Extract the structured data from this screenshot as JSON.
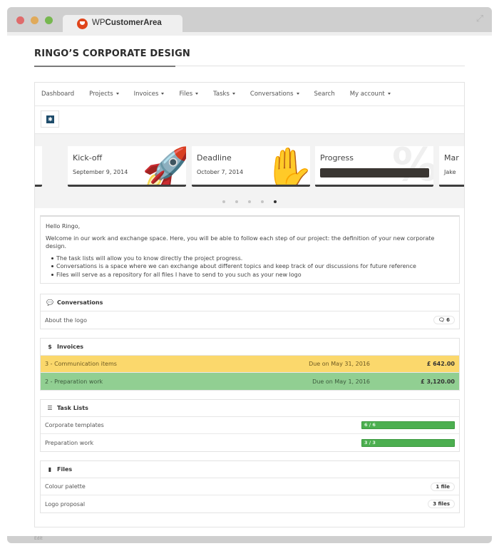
{
  "browser": {
    "tab_title_light": "WP",
    "tab_title_bold": "CustomerArea",
    "brand_color": "#e0451b"
  },
  "page": {
    "title": "RINGO’S CORPORATE DESIGN"
  },
  "nav": {
    "items": [
      {
        "label": "Dashboard",
        "dropdown": false
      },
      {
        "label": "Projects",
        "dropdown": true
      },
      {
        "label": "Invoices",
        "dropdown": true
      },
      {
        "label": "Files",
        "dropdown": true
      },
      {
        "label": "Tasks",
        "dropdown": true
      },
      {
        "label": "Conversations",
        "dropdown": true
      },
      {
        "label": "Search",
        "dropdown": false
      },
      {
        "label": "My account",
        "dropdown": true
      }
    ]
  },
  "toolbar": {
    "icon": "project-icon"
  },
  "carousel": {
    "cards": [
      {
        "title": "Kick-off",
        "subtitle": "September 9, 2014",
        "icon": "rocket-icon"
      },
      {
        "title": "Deadline",
        "subtitle": "October 7, 2014",
        "icon": "hand-stop-icon"
      },
      {
        "title": "Progress",
        "progress": 1.0,
        "icon": "percent-icon"
      },
      {
        "title": "Mar",
        "subtitle": "Jake"
      }
    ],
    "dots": 5,
    "active_dot": 4
  },
  "welcome": {
    "greeting": "Hello Ringo,",
    "intro": "Welcome in our work and exchange space. Here, you will be able to follow each step of our project: the definition of your new corporate design.",
    "bullets": [
      "The task lists will allow you to know directly the project progress.",
      "Conversations is a space where we can exchange about different topics and keep track of our discussions for future reference",
      "Files will serve as a repository for all files I have to send to you such as your new logo"
    ]
  },
  "conversations": {
    "title": "Conversations",
    "items": [
      {
        "label": "About the logo",
        "count": "6"
      }
    ]
  },
  "invoices": {
    "title": "Invoices",
    "items": [
      {
        "label": "3 - Communication items",
        "due": "Due on May 31, 2016",
        "amount": "£ 642.00",
        "status_color": "#fbd86c"
      },
      {
        "label": "2 - Preparation work",
        "due": "Due on May 1, 2016",
        "amount": "£ 3,120.00",
        "status_color": "#91cf92"
      }
    ]
  },
  "tasks": {
    "title": "Task Lists",
    "items": [
      {
        "label": "Corporate templates",
        "progress_text": "6 / 6",
        "progress": 1.0
      },
      {
        "label": "Preparation work",
        "progress_text": "3 / 3",
        "progress": 1.0
      }
    ]
  },
  "files": {
    "title": "Files",
    "items": [
      {
        "label": "Colour palette",
        "count": "1 file"
      },
      {
        "label": "Logo proposal",
        "count": "3 files"
      }
    ]
  },
  "footer": {
    "label": "Edit"
  }
}
